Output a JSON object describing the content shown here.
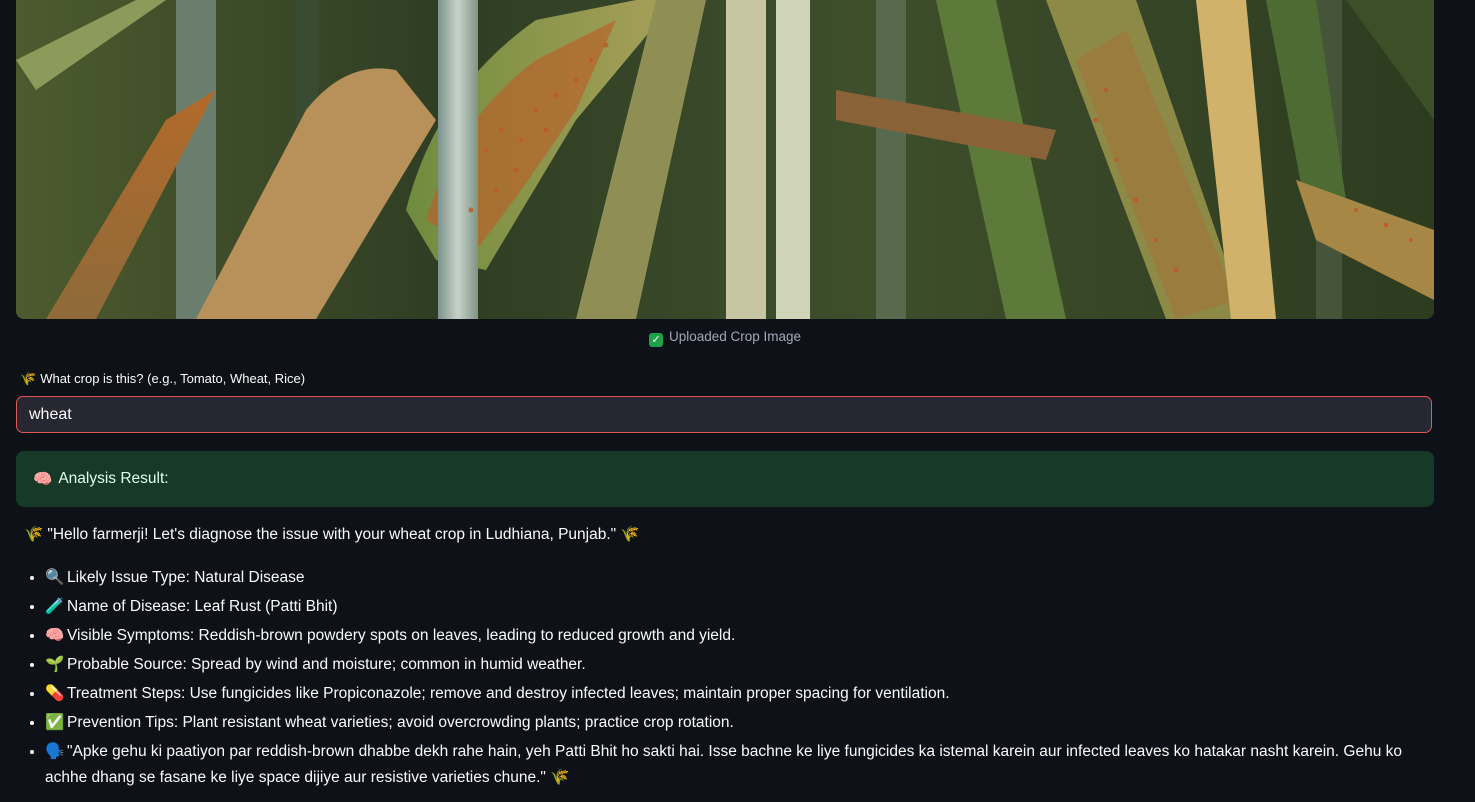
{
  "image": {
    "caption": "Uploaded Crop Image",
    "caption_icon": "check-box-icon"
  },
  "crop_input": {
    "label_emoji": "🌾",
    "label": "What crop is this? (e.g., Tomato, Wheat, Rice)",
    "value": "wheat"
  },
  "result": {
    "emoji": "🧠",
    "title": "Analysis Result:"
  },
  "greeting": {
    "lead_emoji": "🌾",
    "text": "\"Hello farmerji! Let's diagnose the issue with your wheat crop in Ludhiana, Punjab.\"",
    "trail_emoji": "🌾"
  },
  "findings": [
    {
      "emoji": "🔍",
      "text": "Likely Issue Type: Natural Disease"
    },
    {
      "emoji": "🧪",
      "text": "Name of Disease: Leaf Rust (Patti Bhit)"
    },
    {
      "emoji": "🧠",
      "text": "Visible Symptoms: Reddish-brown powdery spots on leaves, leading to reduced growth and yield."
    },
    {
      "emoji": "🌱",
      "text": "Probable Source: Spread by wind and moisture; common in humid weather."
    },
    {
      "emoji": "💊",
      "text": "Treatment Steps: Use fungicides like Propiconazole; remove and destroy infected leaves; maintain proper spacing for ventilation."
    },
    {
      "emoji": "✅",
      "text": "Prevention Tips: Plant resistant wheat varieties; avoid overcrowding plants; practice crop rotation."
    },
    {
      "emoji": "🗣️",
      "text": "\"Apke gehu ki paatiyon par reddish-brown dhabbe dekh rahe hain, yeh Patti Bhit ho sakti hai. Isse bachne ke liye fungicides ka istemal karein aur infected leaves ko hatakar nasht karein. Gehu ko achhe dhang se fasane ke liye space dijiye aur resistive varieties chune.\"",
      "trail_emoji": "🌾"
    }
  ]
}
